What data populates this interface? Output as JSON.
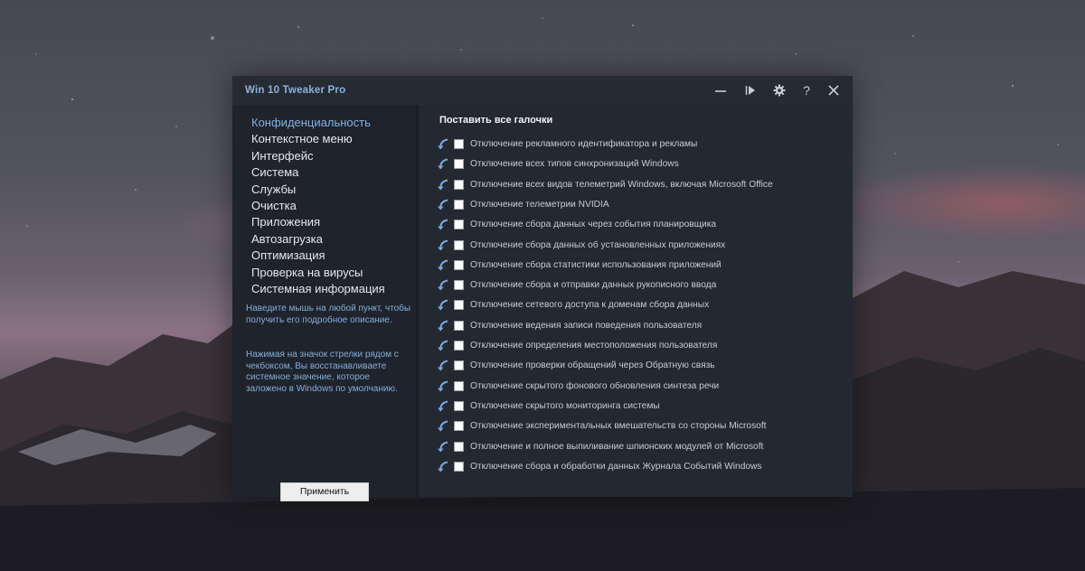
{
  "window": {
    "title": "Win 10 Tweaker Pro"
  },
  "titlebar_buttons": [
    {
      "name": "minimize-button",
      "icon": "minimize-icon"
    },
    {
      "name": "play-button",
      "icon": "play-icon"
    },
    {
      "name": "settings-button",
      "icon": "gear-icon"
    },
    {
      "name": "help-button",
      "icon": "question-icon",
      "glyph": "?"
    },
    {
      "name": "close-button",
      "icon": "close-icon"
    }
  ],
  "sidebar": {
    "active_index": 0,
    "items": [
      "Конфиденциальность",
      "Контекстное меню",
      "Интерфейс",
      "Система",
      "Службы",
      "Очистка",
      "Приложения",
      "Автозагрузка",
      "Оптимизация",
      "Проверка на вирусы",
      "Системная информация"
    ],
    "hint1": "Наведите мышь на любой пункт, чтобы получить его подробное описание.",
    "hint2": "Нажимая на значок стрелки рядом с чекбоксом, Вы восстанавливаете системное значение, которое заложено в Windows по умолчанию.",
    "apply_label": "Применить"
  },
  "content": {
    "select_all_label": "Поставить все галочки",
    "options": [
      {
        "label": "Отключение рекламного идентификатора и рекламы",
        "checked": false
      },
      {
        "label": "Отключение всех типов синхронизаций Windows",
        "checked": false
      },
      {
        "label": "Отключение всех видов телеметрий Windows, включая Microsoft Office",
        "checked": false
      },
      {
        "label": "Отключение телеметрии NVIDIA",
        "checked": false
      },
      {
        "label": "Отключение сбора данных через события планировщика",
        "checked": false
      },
      {
        "label": "Отключение сбора данных об установленных приложениях",
        "checked": false
      },
      {
        "label": "Отключение сбора статистики использования приложений",
        "checked": false
      },
      {
        "label": "Отключение сбора и отправки данных рукописного ввода",
        "checked": false
      },
      {
        "label": "Отключение сетевого доступа к доменам сбора данных",
        "checked": false
      },
      {
        "label": "Отключение ведения записи поведения пользователя",
        "checked": false
      },
      {
        "label": "Отключение определения местоположения пользователя",
        "checked": false
      },
      {
        "label": "Отключение проверки обращений через Обратную связь",
        "checked": false
      },
      {
        "label": "Отключение скрытого фонового обновления синтеза речи",
        "checked": false
      },
      {
        "label": "Отключение скрытого мониторинга системы",
        "checked": false
      },
      {
        "label": "Отключение экспериментальных вмешательств со стороны Microsoft",
        "checked": false
      },
      {
        "label": "Отключение и полное выпиливание шпионских модулей от Microsoft",
        "checked": false
      },
      {
        "label": "Отключение сбора и обработки данных Журнала Событий Windows",
        "checked": false
      }
    ]
  },
  "colors": {
    "accent": "#84b0e0",
    "restore_arrow": "#7ea9dc",
    "window_bg": "#232831",
    "sidebar_bg": "#1f232b"
  }
}
